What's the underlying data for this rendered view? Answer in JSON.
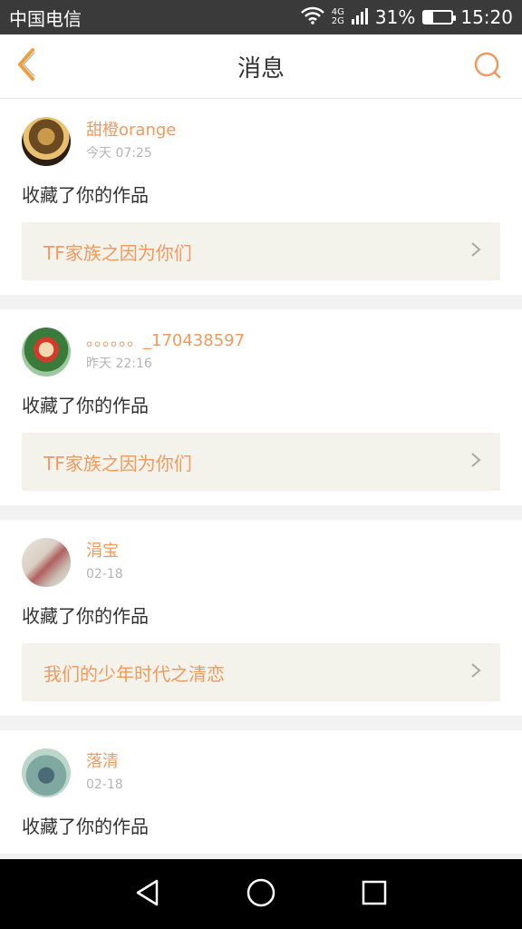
{
  "status_bar": {
    "carrier": "中国电信",
    "network_top": "4G",
    "network_bottom": "2G",
    "battery_percent": "31%",
    "battery_level": 0.31,
    "time": "15:20",
    "icons": [
      "wifi-icon",
      "signal-icon",
      "battery-icon"
    ]
  },
  "header": {
    "title": "消息",
    "back_icon": "back-chevron-icon",
    "search_icon": "search-icon",
    "accent": "#f09a5d"
  },
  "messages": [
    {
      "username": "甜橙orange",
      "time": "今天 07:25",
      "action": "收藏了你的作品",
      "work_title": "TF家族之因为你们"
    },
    {
      "username": "。。。。。。_170438597",
      "time": "昨天 22:16",
      "action": "收藏了你的作品",
      "work_title": "TF家族之因为你们"
    },
    {
      "username": "涓宝",
      "time": "02-18",
      "action": "收藏了你的作品",
      "work_title": "我们的少年时代之清恋"
    },
    {
      "username": "落清",
      "time": "02-18",
      "action": "收藏了你的作品",
      "work_title": ""
    }
  ],
  "nav_bar": {
    "icons": [
      "back-triangle-icon",
      "home-circle-icon",
      "recents-square-icon"
    ]
  }
}
